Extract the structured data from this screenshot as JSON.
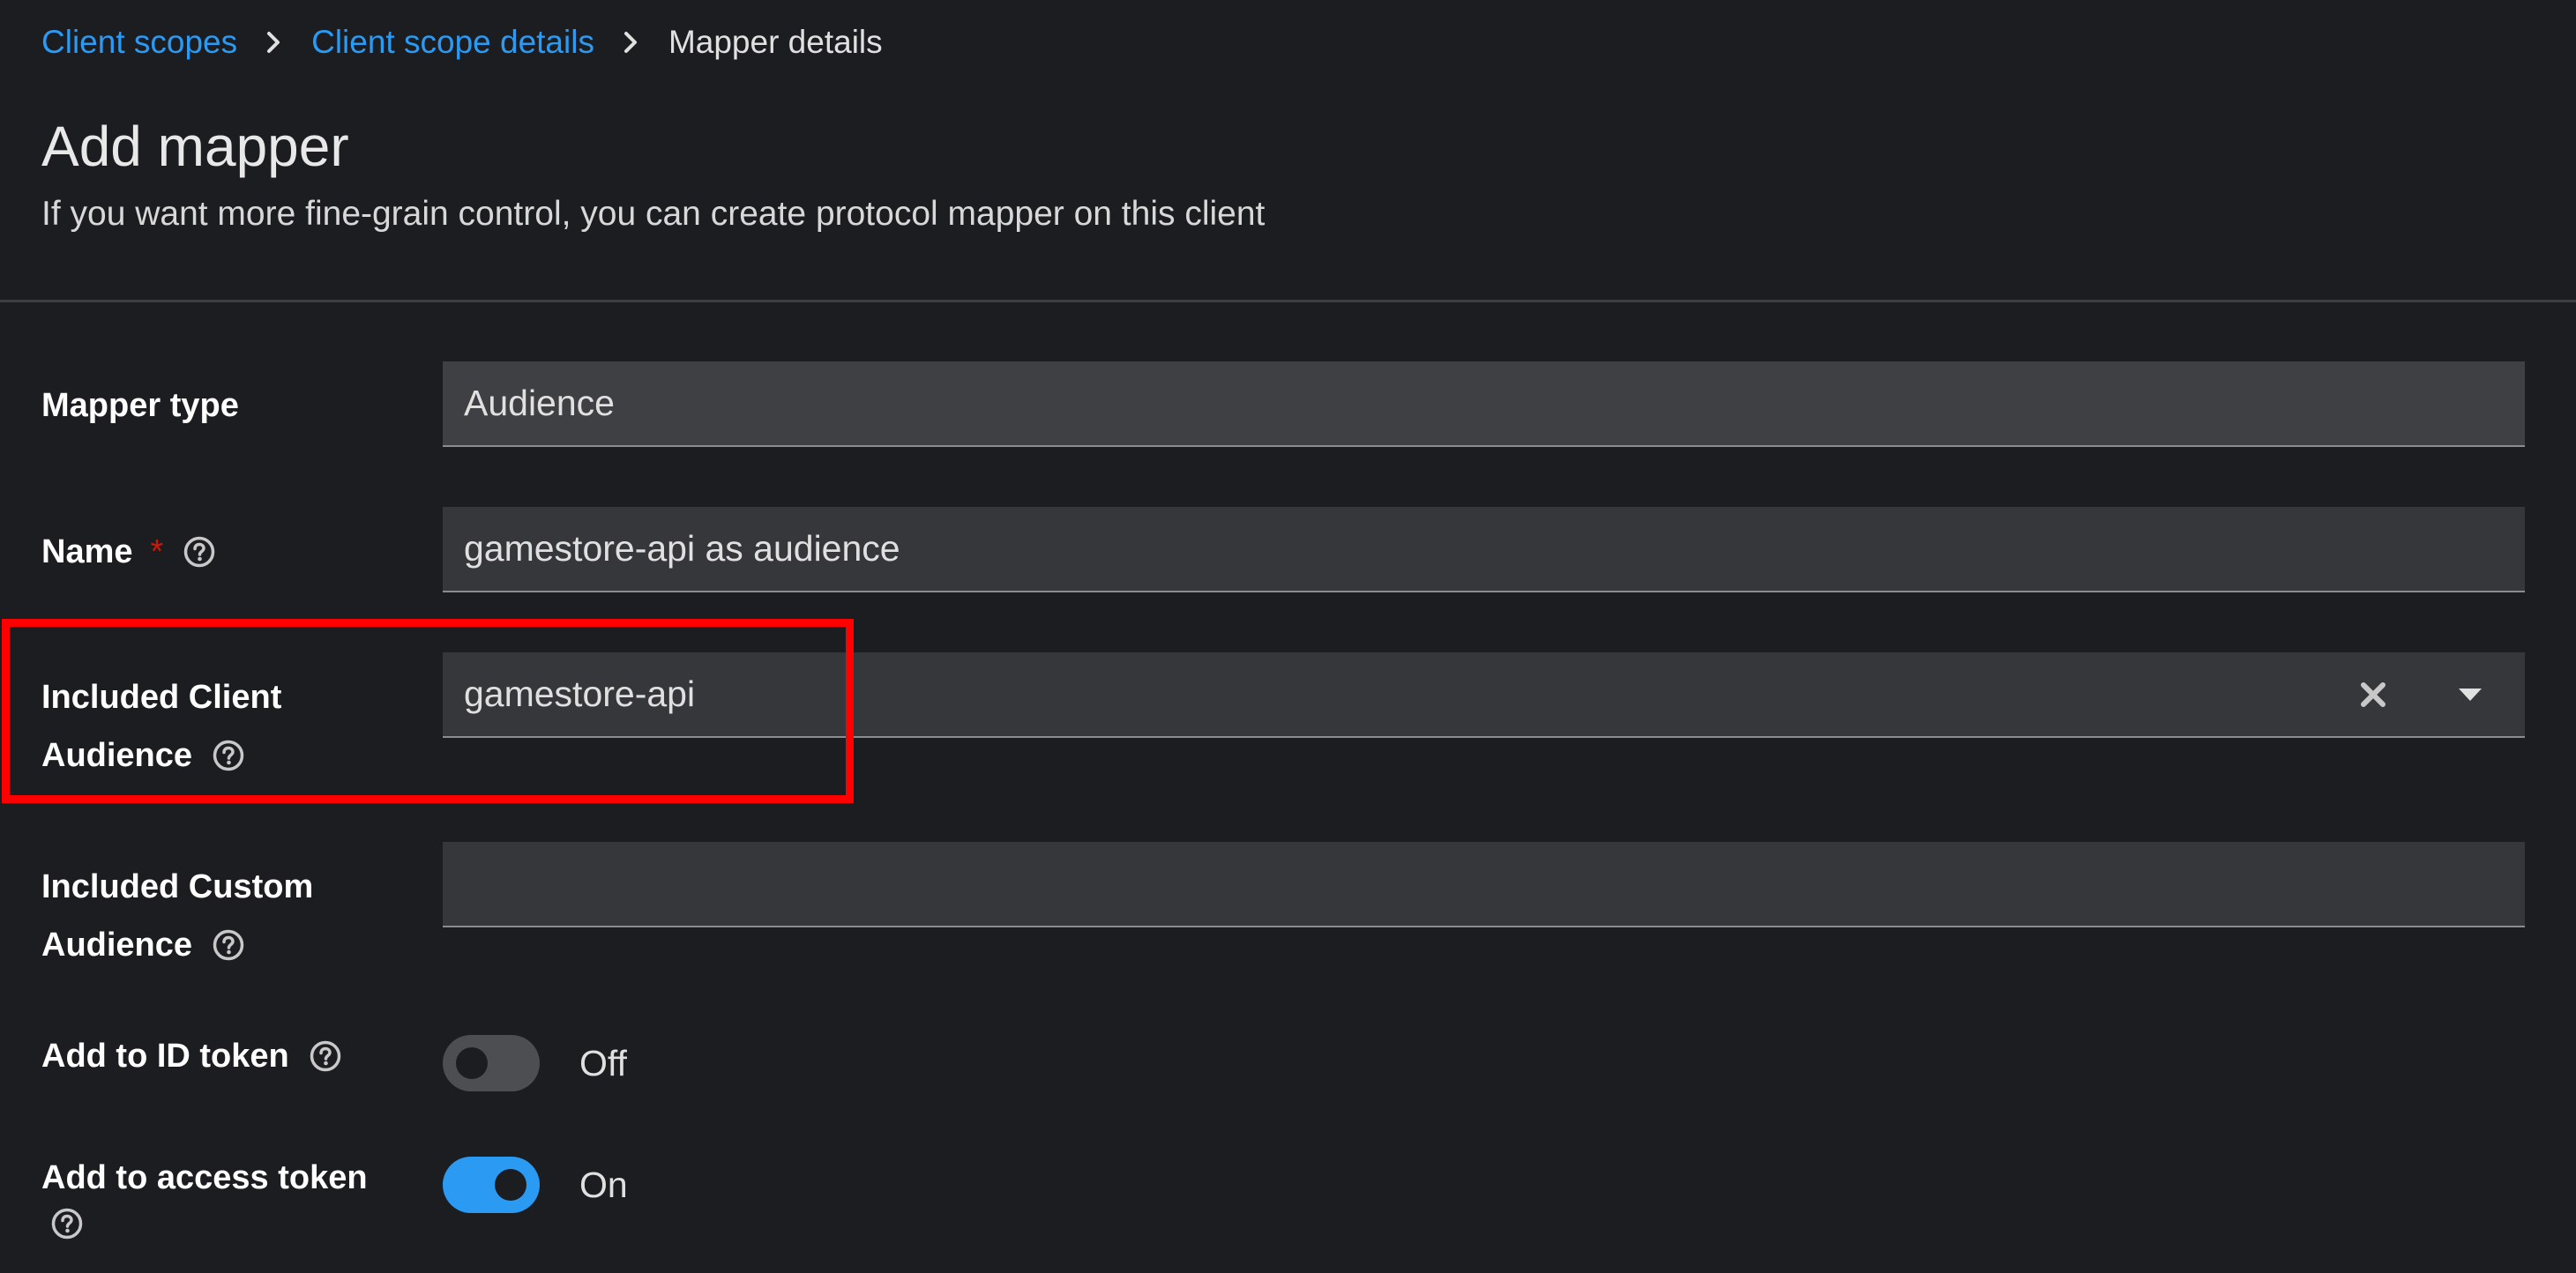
{
  "breadcrumb": {
    "items": [
      {
        "label": "Client scopes"
      },
      {
        "label": "Client scope details"
      }
    ],
    "current": "Mapper details"
  },
  "header": {
    "title": "Add mapper",
    "description": "If you want more fine-grain control, you can create protocol mapper on this client"
  },
  "form": {
    "mapper_type": {
      "label": "Mapper type",
      "value": "Audience"
    },
    "name": {
      "label": "Name",
      "required_mark": "*",
      "value": "gamestore-api as audience"
    },
    "included_client_audience": {
      "label_line1": "Included Client",
      "label_line2": "Audience",
      "value": "gamestore-api"
    },
    "included_custom_audience": {
      "label_line1": "Included Custom",
      "label_line2": "Audience",
      "value": ""
    },
    "add_to_id_token": {
      "label": "Add to ID token",
      "state": "Off"
    },
    "add_to_access_token": {
      "label": "Add to access token",
      "state": "On"
    }
  },
  "icons": {
    "breadcrumb_separator": "chevron-right-icon",
    "help": "question-circle-icon",
    "clear": "close-icon",
    "dropdown": "caret-down-icon"
  },
  "colors": {
    "background": "#1b1d21",
    "link": "#2b9af3",
    "field_bg": "#36373b",
    "toggle_on": "#2b9af3",
    "toggle_off": "#4d4e52",
    "highlight": "#ff0000",
    "required": "#c9190b"
  }
}
